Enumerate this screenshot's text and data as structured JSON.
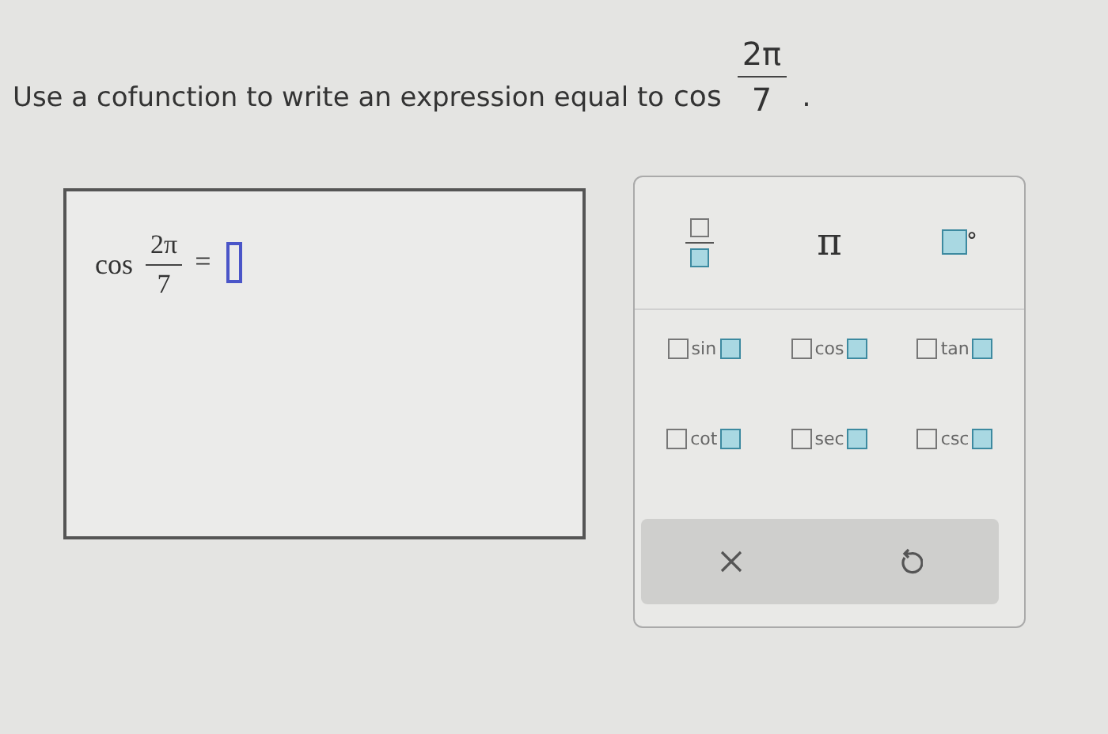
{
  "question": {
    "text": "Use a cofunction to write an expression equal to",
    "function": "cos",
    "numerator": "2π",
    "denominator": "7",
    "end": "."
  },
  "answer": {
    "function": "cos",
    "numerator": "2π",
    "denominator": "7",
    "equals": "="
  },
  "palette": {
    "templates": [
      {
        "kind": "fraction"
      },
      {
        "kind": "symbol",
        "label": "π"
      },
      {
        "kind": "degree",
        "label": "°"
      }
    ],
    "functions": [
      {
        "name": "sin"
      },
      {
        "name": "cos"
      },
      {
        "name": "tan"
      },
      {
        "name": "cot"
      },
      {
        "name": "sec"
      },
      {
        "name": "csc"
      }
    ],
    "actions": [
      {
        "kind": "clear"
      },
      {
        "kind": "undo"
      }
    ]
  }
}
